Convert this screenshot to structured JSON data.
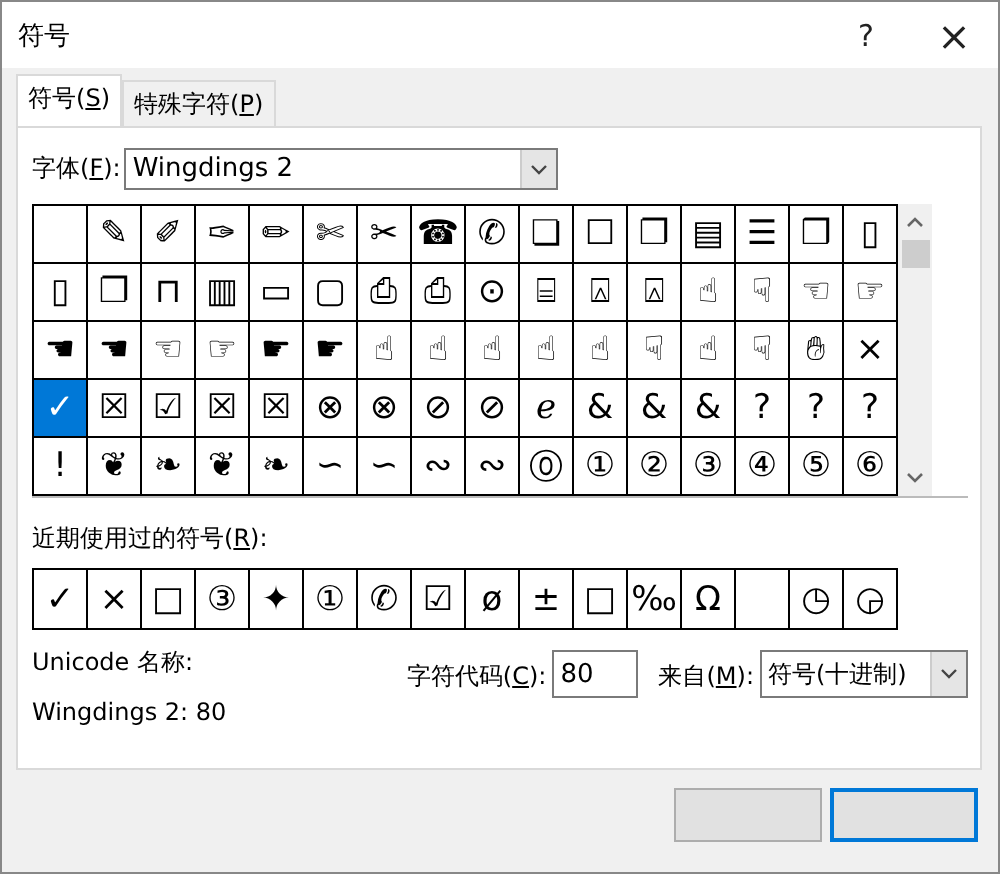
{
  "window": {
    "title": "符号",
    "help": "?",
    "close": "×"
  },
  "tabs": [
    {
      "label": "符号(S)",
      "selected": true
    },
    {
      "label": "特殊字符(P)",
      "selected": false
    }
  ],
  "font": {
    "label": "字体(F):",
    "value": "Wingdings 2"
  },
  "grid": [
    [
      {
        "selected": false
      },
      {
        "glyph": "✎",
        "selected": false
      },
      {
        "glyph": "✐",
        "selected": false
      },
      {
        "glyph": "✑",
        "selected": false
      },
      {
        "glyph": "✏",
        "selected": false
      },
      {
        "glyph": "✄",
        "selected": false
      },
      {
        "glyph": "✂",
        "selected": false
      },
      {
        "glyph": "☎",
        "selected": false
      },
      {
        "glyph": "✆",
        "selected": false
      },
      {
        "glyph": "❏",
        "selected": false
      },
      {
        "glyph": "☐",
        "selected": false
      },
      {
        "glyph": "❐",
        "selected": false
      },
      {
        "glyph": "▤",
        "selected": false
      },
      {
        "glyph": "☰",
        "selected": false
      },
      {
        "glyph": "❒",
        "selected": false
      },
      {
        "glyph": "▯",
        "selected": false
      }
    ],
    [
      {
        "glyph": "▯",
        "selected": false
      },
      {
        "glyph": "❐",
        "selected": false
      },
      {
        "glyph": "⊓",
        "selected": false
      },
      {
        "glyph": "▥",
        "selected": false
      },
      {
        "glyph": "▭",
        "selected": false
      },
      {
        "glyph": "▢",
        "selected": false
      },
      {
        "glyph": "⎙",
        "selected": false
      },
      {
        "glyph": "⎙",
        "selected": false
      },
      {
        "glyph": "⊙",
        "selected": false
      },
      {
        "glyph": "⌸",
        "selected": false
      },
      {
        "glyph": "⍓",
        "selected": false
      },
      {
        "glyph": "⍓",
        "selected": false
      },
      {
        "glyph": "☝",
        "selected": false
      },
      {
        "glyph": "☟",
        "selected": false
      },
      {
        "glyph": "☜",
        "selected": false
      },
      {
        "glyph": "☞",
        "selected": false
      }
    ],
    [
      {
        "glyph": "☚",
        "selected": false
      },
      {
        "glyph": "☚",
        "selected": false
      },
      {
        "glyph": "☜",
        "selected": false
      },
      {
        "glyph": "☞",
        "selected": false
      },
      {
        "glyph": "☛",
        "selected": false
      },
      {
        "glyph": "☛",
        "selected": false
      },
      {
        "glyph": "☝",
        "selected": false
      },
      {
        "glyph": "☝",
        "selected": false
      },
      {
        "glyph": "☝",
        "selected": false
      },
      {
        "glyph": "☝",
        "selected": false
      },
      {
        "glyph": "☝",
        "selected": false
      },
      {
        "glyph": "☟",
        "selected": false
      },
      {
        "glyph": "☝",
        "selected": false
      },
      {
        "glyph": "☟",
        "selected": false
      },
      {
        "glyph": "✋︎",
        "selected": false
      },
      {
        "glyph": "×",
        "selected": false
      }
    ],
    [
      {
        "glyph": "✓",
        "selected": true
      },
      {
        "glyph": "☒",
        "selected": false
      },
      {
        "glyph": "☑",
        "selected": false
      },
      {
        "glyph": "☒",
        "selected": false
      },
      {
        "glyph": "☒",
        "selected": false
      },
      {
        "glyph": "⊗",
        "selected": false
      },
      {
        "glyph": "⊗",
        "selected": false
      },
      {
        "glyph": "⊘",
        "selected": false
      },
      {
        "glyph": "⊘",
        "selected": false
      },
      {
        "glyph": "ℯ",
        "selected": false
      },
      {
        "glyph": "&",
        "selected": false
      },
      {
        "glyph": "&",
        "selected": false
      },
      {
        "glyph": "&",
        "selected": false
      },
      {
        "glyph": "?",
        "selected": false
      },
      {
        "glyph": "?",
        "selected": false
      },
      {
        "glyph": "?",
        "selected": false
      }
    ],
    [
      {
        "glyph": "!",
        "selected": false
      },
      {
        "glyph": "❦",
        "selected": false
      },
      {
        "glyph": "❧",
        "selected": false
      },
      {
        "glyph": "❦",
        "selected": false
      },
      {
        "glyph": "❧",
        "selected": false
      },
      {
        "glyph": "∽",
        "selected": false
      },
      {
        "glyph": "∽",
        "selected": false
      },
      {
        "glyph": "∾",
        "selected": false
      },
      {
        "glyph": "∾",
        "selected": false
      },
      {
        "glyph": "⓪",
        "selected": false
      },
      {
        "glyph": "①",
        "selected": false
      },
      {
        "glyph": "②",
        "selected": false
      },
      {
        "glyph": "③",
        "selected": false
      },
      {
        "glyph": "④",
        "selected": false
      },
      {
        "glyph": "⑤",
        "selected": false
      },
      {
        "glyph": "⑥",
        "selected": false
      }
    ]
  ],
  "recent": {
    "label": "近期使用过的符号(R):",
    "symbols": [
      {
        "kind": "glyph",
        "glyph": "✓"
      },
      {
        "kind": "glyph",
        "glyph": "×"
      },
      {
        "kind": "glyph",
        "glyph": "□"
      },
      {
        "kind": "glyph",
        "glyph": "③"
      },
      {
        "kind": "glyph",
        "glyph": "✦"
      },
      {
        "kind": "glyph",
        "glyph": "①"
      },
      {
        "kind": "glyph",
        "glyph": "✆"
      },
      {
        "kind": "glyph",
        "glyph": "☑"
      },
      {
        "kind": "glyph",
        "glyph": "ø"
      },
      {
        "kind": "glyph",
        "glyph": "±"
      },
      {
        "kind": "glyph",
        "glyph": "□"
      },
      {
        "kind": "glyph",
        "glyph": "‰"
      },
      {
        "kind": "glyph",
        "glyph": "Ω"
      },
      {
        "kind": "blank"
      },
      {
        "kind": "glyph",
        "glyph": "◷"
      },
      {
        "kind": "glyph",
        "glyph": "◶"
      }
    ]
  },
  "unicode_name": {
    "label": "Unicode 名称:",
    "value": "Wingdings 2: 80"
  },
  "char_code": {
    "label": "字符代码(C):",
    "value": "80"
  },
  "from": {
    "label": "来自(M):",
    "value": "符号(十进制)"
  }
}
